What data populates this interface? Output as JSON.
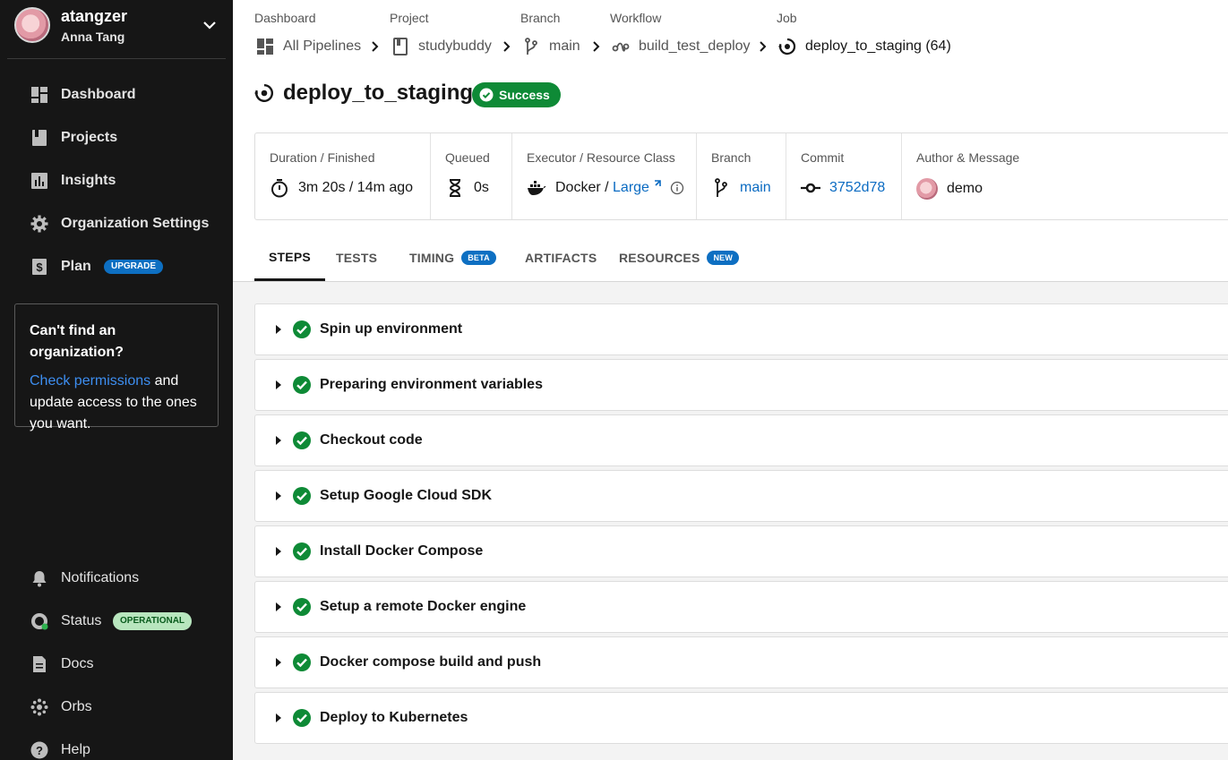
{
  "user": {
    "username": "atangzer",
    "full_name": "Anna Tang"
  },
  "sidebar": {
    "primary": [
      {
        "label": "Dashboard",
        "icon": "dashboard-icon"
      },
      {
        "label": "Projects",
        "icon": "projects-icon"
      },
      {
        "label": "Insights",
        "icon": "insights-icon"
      },
      {
        "label": "Organization Settings",
        "icon": "gear-icon"
      },
      {
        "label": "Plan",
        "icon": "dollar-icon",
        "badge": "UPGRADE"
      }
    ],
    "org_box": {
      "heading": "Can't find an organization?",
      "link": "Check permissions",
      "text_after_link": " and update access to the ones you want."
    },
    "secondary": [
      {
        "label": "Notifications",
        "icon": "bell-icon"
      },
      {
        "label": "Status",
        "icon": "status-gauge-icon",
        "badge": "OPERATIONAL"
      },
      {
        "label": "Docs",
        "icon": "docs-icon"
      },
      {
        "label": "Orbs",
        "icon": "orbs-icon"
      },
      {
        "label": "Help",
        "icon": "help-icon"
      }
    ]
  },
  "breadcrumb": {
    "labels": [
      "Dashboard",
      "Project",
      "Branch",
      "Workflow",
      "Job"
    ],
    "items": [
      "All Pipelines",
      "studybuddy",
      "main",
      "build_test_deploy",
      "deploy_to_staging (64)"
    ]
  },
  "job": {
    "title": "deploy_to_staging",
    "status": "Success",
    "status_color": "#0e8a36"
  },
  "summary": {
    "duration_label": "Duration / Finished",
    "duration_value": "3m 20s / 14m ago",
    "queued_label": "Queued",
    "queued_value": "0s",
    "executor_label": "Executor / Resource Class",
    "executor_value": "Docker / ",
    "resource_class": "Large",
    "branch_label": "Branch",
    "branch_value": "main",
    "commit_label": "Commit",
    "commit_value": "3752d78",
    "author_label": "Author & Message",
    "author_message": "demo"
  },
  "tabs": [
    {
      "label": "STEPS",
      "active": true
    },
    {
      "label": "TESTS"
    },
    {
      "label": "TIMING",
      "badge": "BETA"
    },
    {
      "label": "ARTIFACTS"
    },
    {
      "label": "RESOURCES",
      "badge": "NEW"
    }
  ],
  "steps": [
    "Spin up environment",
    "Preparing environment variables",
    "Checkout code",
    "Setup Google Cloud SDK",
    "Install Docker Compose",
    "Setup a remote Docker engine",
    "Docker compose build and push",
    "Deploy to Kubernetes"
  ],
  "colors": {
    "accent": "#0b6bc2",
    "success": "#0e8a36",
    "sidebar_bg": "#161616"
  }
}
